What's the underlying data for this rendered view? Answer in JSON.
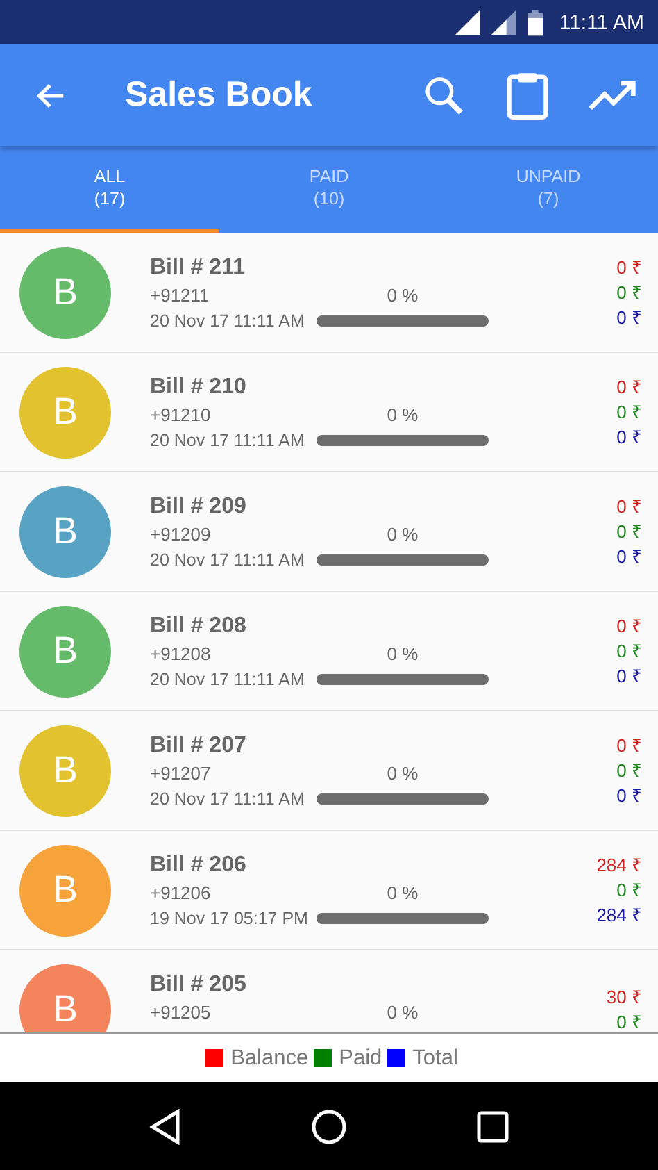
{
  "status_bar": {
    "time": "11:11 AM"
  },
  "app_bar": {
    "title": "Sales Book"
  },
  "tabs": [
    {
      "label": "ALL",
      "count": "(17)",
      "selected": true
    },
    {
      "label": "PAID",
      "count": "(10)",
      "selected": false
    },
    {
      "label": "UNPAID",
      "count": "(7)",
      "selected": false
    }
  ],
  "bills": [
    {
      "initial": "B",
      "color": "#66bb6a",
      "title": "Bill # 211",
      "phone": "+91211",
      "date": "20 Nov 17 11:11 AM",
      "percent": "0 %",
      "level": 0,
      "balance": "0 ₹",
      "paid": "0 ₹",
      "total": "0 ₹"
    },
    {
      "initial": "B",
      "color": "#e2c32f",
      "title": "Bill # 210",
      "phone": "+91210",
      "date": "20 Nov 17 11:11 AM",
      "percent": "0 %",
      "level": 0,
      "balance": "0 ₹",
      "paid": "0 ₹",
      "total": "0 ₹"
    },
    {
      "initial": "B",
      "color": "#58a3c4",
      "title": "Bill # 209",
      "phone": "+91209",
      "date": "20 Nov 17 11:11 AM",
      "percent": "0 %",
      "level": 0,
      "balance": "0 ₹",
      "paid": "0 ₹",
      "total": "0 ₹"
    },
    {
      "initial": "B",
      "color": "#66bb6a",
      "title": "Bill # 208",
      "phone": "+91208",
      "date": "20 Nov 17 11:11 AM",
      "percent": "0 %",
      "level": 0,
      "balance": "0 ₹",
      "paid": "0 ₹",
      "total": "0 ₹"
    },
    {
      "initial": "B",
      "color": "#e2c32f",
      "title": "Bill # 207",
      "phone": "+91207",
      "date": "20 Nov 17 11:11 AM",
      "percent": "0 %",
      "level": 0,
      "balance": "0 ₹",
      "paid": "0 ₹",
      "total": "0 ₹"
    },
    {
      "initial": "B",
      "color": "#f7a33b",
      "title": "Bill # 206",
      "phone": "+91206",
      "date": "19 Nov 17 05:17 PM",
      "percent": "0 %",
      "level": 0,
      "balance": "284 ₹",
      "paid": "0 ₹",
      "total": "284 ₹"
    },
    {
      "initial": "B",
      "color": "#f4845c",
      "title": "Bill # 205",
      "phone": "+91205",
      "percent": "0 %",
      "balance": "30 ₹",
      "paid": "0 ₹"
    }
  ],
  "legend": [
    {
      "label": "Balance",
      "color": "#ff0000"
    },
    {
      "label": "Paid",
      "color": "#008000"
    },
    {
      "label": "Total",
      "color": "#0000ff"
    }
  ]
}
